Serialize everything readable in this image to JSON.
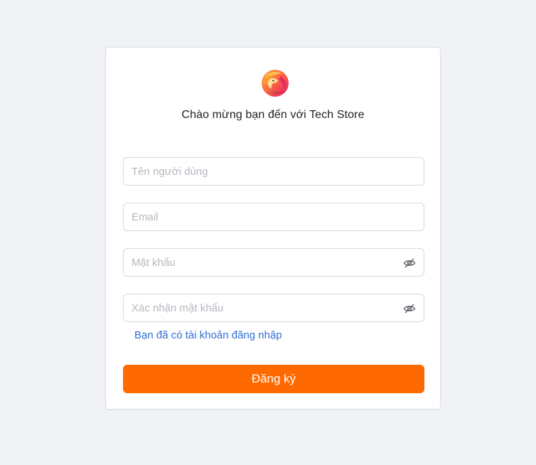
{
  "brand": {
    "logo_icon": "lion-logo-icon",
    "welcome_text": "Chào mừng bạn đến với Tech Store"
  },
  "form": {
    "username_placeholder": "Tên người dùng",
    "email_placeholder": "Email",
    "password_placeholder": "Mật khẩu",
    "confirm_password_placeholder": "Xác nhận mật khẩu",
    "password_visibility_icon": "eye-slash-icon",
    "login_link": "Bạn đã có tài khoản đăng nhập",
    "submit_label": "Đăng ký"
  },
  "colors": {
    "page_background": "#f0f2f5",
    "accent": "#ff6a00",
    "link": "#2f6fd6",
    "logo_gradient_start": "#ff9a3c",
    "logo_gradient_end": "#e0246a"
  }
}
